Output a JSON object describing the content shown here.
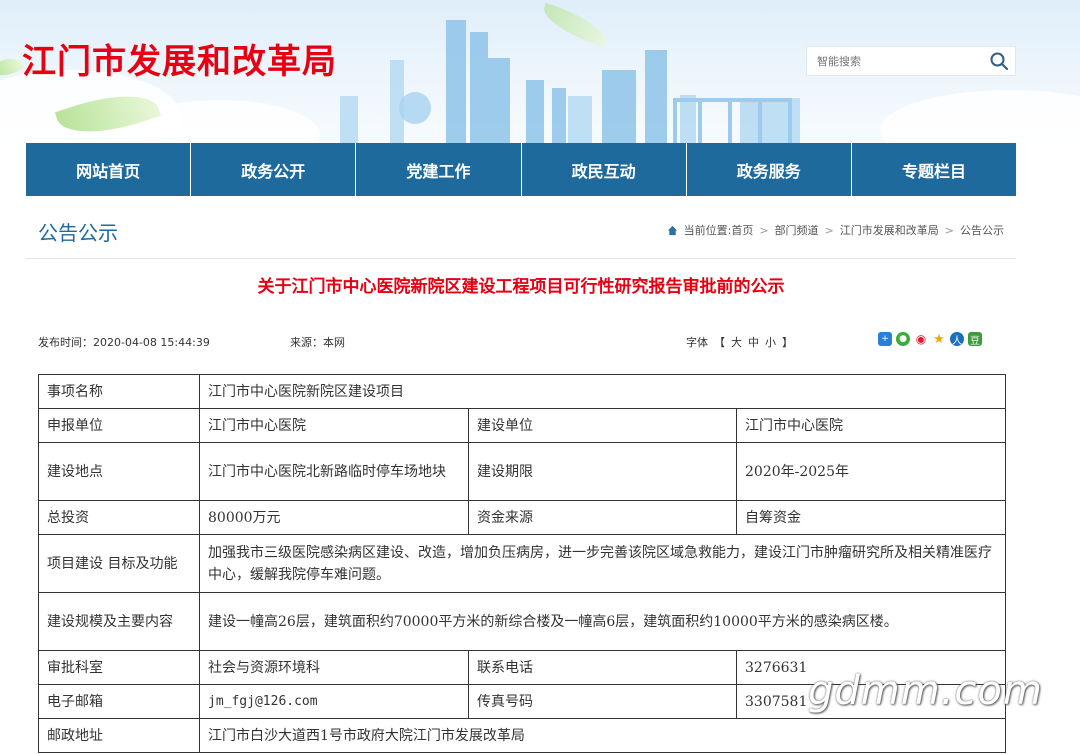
{
  "header": {
    "site_title": "江门市发展和改革局",
    "search_placeholder": "智能搜索"
  },
  "nav": {
    "items": [
      "网站首页",
      "政务公开",
      "党建工作",
      "政民互动",
      "政务服务",
      "专题栏目"
    ]
  },
  "section": {
    "title": "公告公示"
  },
  "breadcrumb": {
    "label": "当前位置:",
    "items": [
      "首页",
      "部门频道",
      "江门市发展和改革局",
      "公告公示"
    ],
    "separator": ">"
  },
  "article": {
    "title": "关于江门市中心医院新院区建设工程项目可行性研究报告审批前的公示",
    "publish_time": "发布时间：2020-04-08 15:44:39",
    "source": "来源：本网",
    "font_label": "字体",
    "font_open": "【",
    "font_close": "】",
    "font_sizes": [
      "大",
      "中",
      "小"
    ]
  },
  "share_icons": [
    "qzone-icon",
    "wechat-icon",
    "weibo-icon",
    "favorite-icon",
    "renren-icon",
    "douban-icon"
  ],
  "table": {
    "item_name_label": "事项名称",
    "item_name_value": "江门市中心医院新院区建设项目",
    "applicant_label": "申报单位",
    "applicant_value": "江门市中心医院",
    "builder_label": "建设单位",
    "builder_value": "江门市中心医院",
    "location_label": "建设地点",
    "location_value": "江门市中心医院北新路临时停车场地块",
    "period_label": "建设期限",
    "period_value": "2020年-2025年",
    "investment_label": "总投资",
    "investment_value": "80000万元",
    "fund_label": "资金来源",
    "fund_value": "自筹资金",
    "goal_label": "项目建设 目标及功能",
    "goal_value": "加强我市三级医院感染病区建设、改造，增加负压病房，进一步完善该院区域急救能力，建设江门市肿瘤研究所及相关精准医疗中心，缓解我院停车难问题。",
    "scale_label": "建设规模及主要内容",
    "scale_value": "建设一幢高26层，建筑面积约70000平方米的新综合楼及一幢高6层，建筑面积约10000平方米的感染病区楼。",
    "dept_label": "审批科室",
    "dept_value": "社会与资源环境科",
    "phone_label": "联系电话",
    "phone_value": "3276631",
    "email_label": "电子邮箱",
    "email_value": "jm_fgj@126.com",
    "fax_label": "传真号码",
    "fax_value": "3307581",
    "address_label": "邮政地址",
    "address_value": "江门市白沙大道西1号市政府大院江门市发展改革局"
  },
  "watermark": "gdmm.com",
  "colors": {
    "brand_red": "#e60012",
    "nav_blue": "#1e6a9c"
  }
}
